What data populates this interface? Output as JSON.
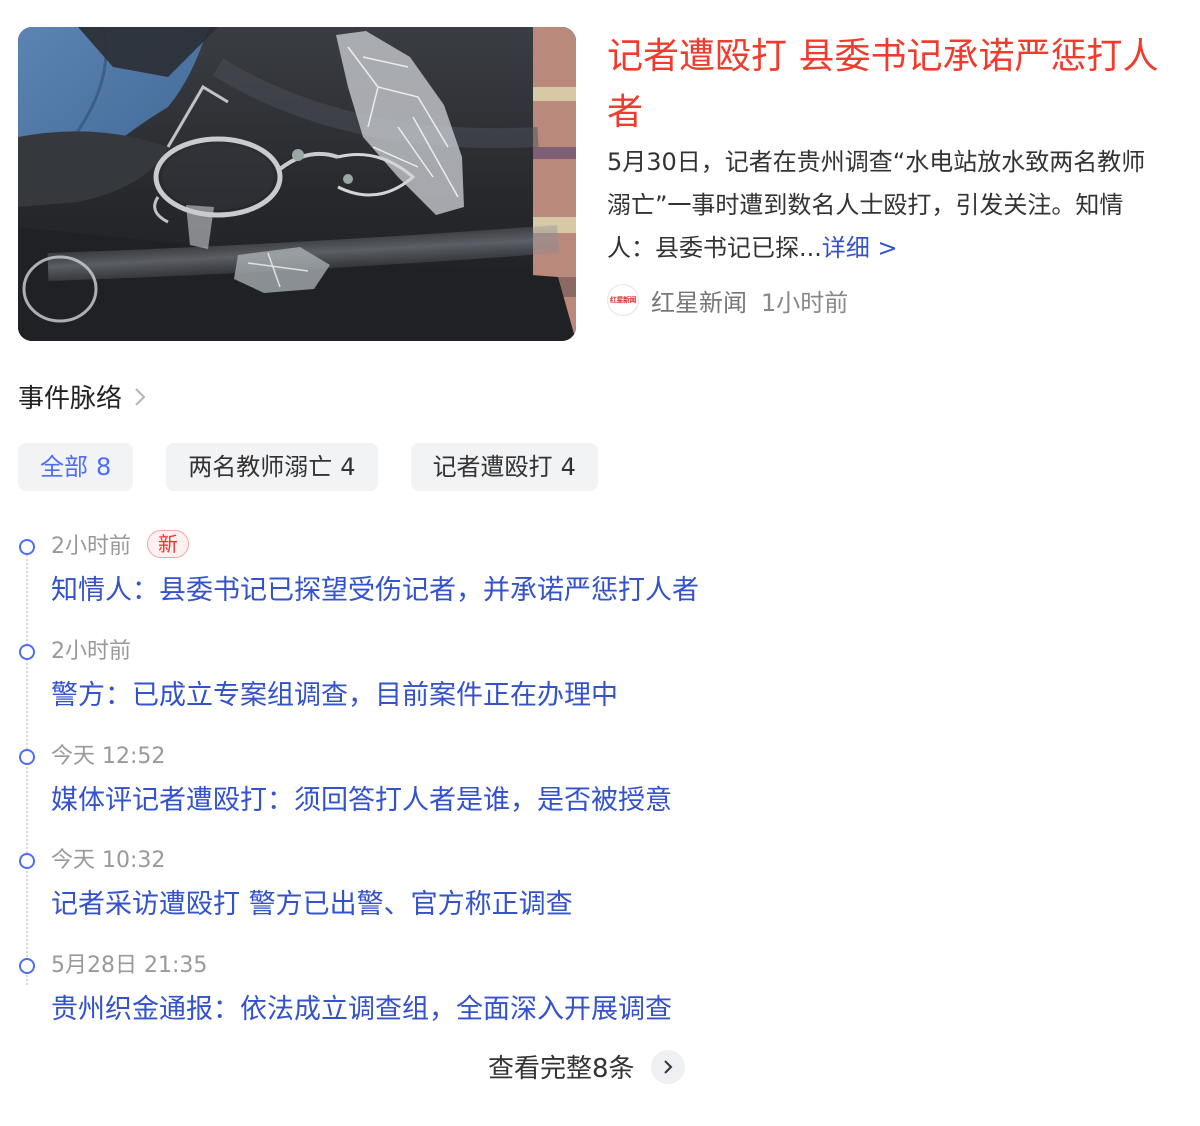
{
  "news_card": {
    "headline": "记者遭殴打 县委书记承诺严惩打人者",
    "summary": "5月30日，记者在贵州调查“水电站放水致两名教师溺亡”一事时遭到数名人士殴打，引发关注。知情人：县委书记已探...",
    "more_link": "详细 >",
    "source_logo_text": "红星新闻",
    "source_name": "红星新闻",
    "time": "1小时前"
  },
  "section": {
    "title": "事件脉络"
  },
  "tabs": [
    {
      "label": "全部",
      "count": "8",
      "active": true
    },
    {
      "label": "两名教师溺亡",
      "count": "4",
      "active": false
    },
    {
      "label": "记者遭殴打",
      "count": "4",
      "active": false
    }
  ],
  "timeline": [
    {
      "time": "2小时前",
      "badge": "新",
      "title": "知情人：县委书记已探望受伤记者，并承诺严惩打人者"
    },
    {
      "time": "2小时前",
      "title": "警方：已成立专案组调查，目前案件正在办理中"
    },
    {
      "time": "今天 12:52",
      "title": "媒体评记者遭殴打：须回答打人者是谁，是否被授意"
    },
    {
      "time": "今天 10:32",
      "title": "记者采访遭殴打 警方已出警、官方称正调查"
    },
    {
      "time": "5月28日 21:35",
      "title": "贵州织金通报：依法成立调查组，全面深入开展调查"
    }
  ],
  "view_all": "查看完整8条",
  "colors": {
    "headline": "#f03c2e",
    "link": "#3352cc",
    "accent": "#4e6ef2",
    "badge": "#f73131"
  }
}
